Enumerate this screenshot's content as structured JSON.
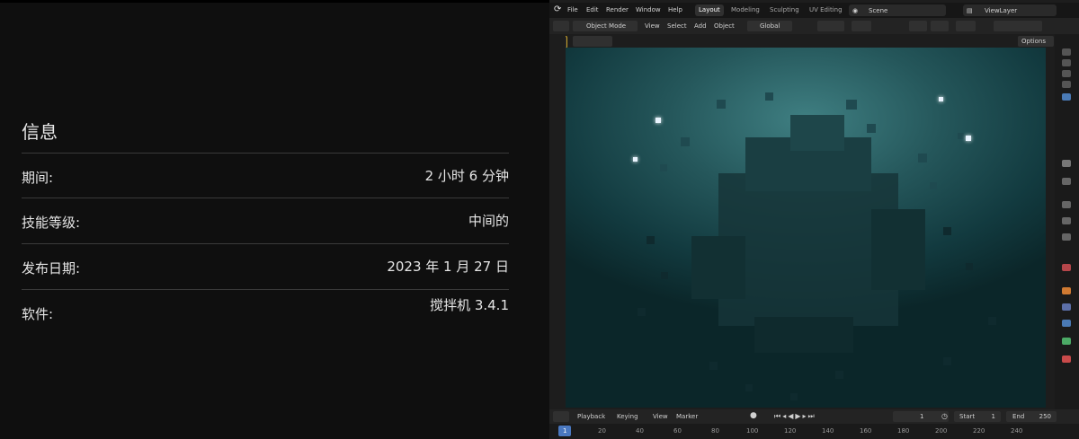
{
  "info": {
    "title": "信息",
    "rows": [
      {
        "label": "期间:",
        "value": "2 小时 6 分钟"
      },
      {
        "label": "技能等级:",
        "value": "中间的"
      },
      {
        "label": "发布日期:",
        "value": "2023 年 1 月 27 日"
      },
      {
        "label": "软件:",
        "value": "搅拌机 3.4.1"
      }
    ]
  },
  "blender": {
    "menu": [
      "File",
      "Edit",
      "Render",
      "Window",
      "Help"
    ],
    "workspaces": [
      "Layout",
      "Modeling",
      "Sculpting",
      "UV Editing"
    ],
    "scene": "Scene",
    "view_layer": "ViewLayer",
    "header": {
      "mode": "Object Mode",
      "view": "View",
      "select": "Select",
      "add": "Add",
      "object": "Object",
      "orientation": "Global",
      "options": "Options"
    },
    "timeline": {
      "playback": "Playback",
      "keying": "Keying",
      "view": "View",
      "marker": "Marker",
      "current_frame": "1",
      "start_label": "Start",
      "start_value": "1",
      "end_label": "End",
      "end_value": "250"
    },
    "ruler": [
      "1",
      "20",
      "40",
      "60",
      "80",
      "100",
      "120",
      "140",
      "160",
      "180",
      "200",
      "220",
      "240"
    ]
  }
}
